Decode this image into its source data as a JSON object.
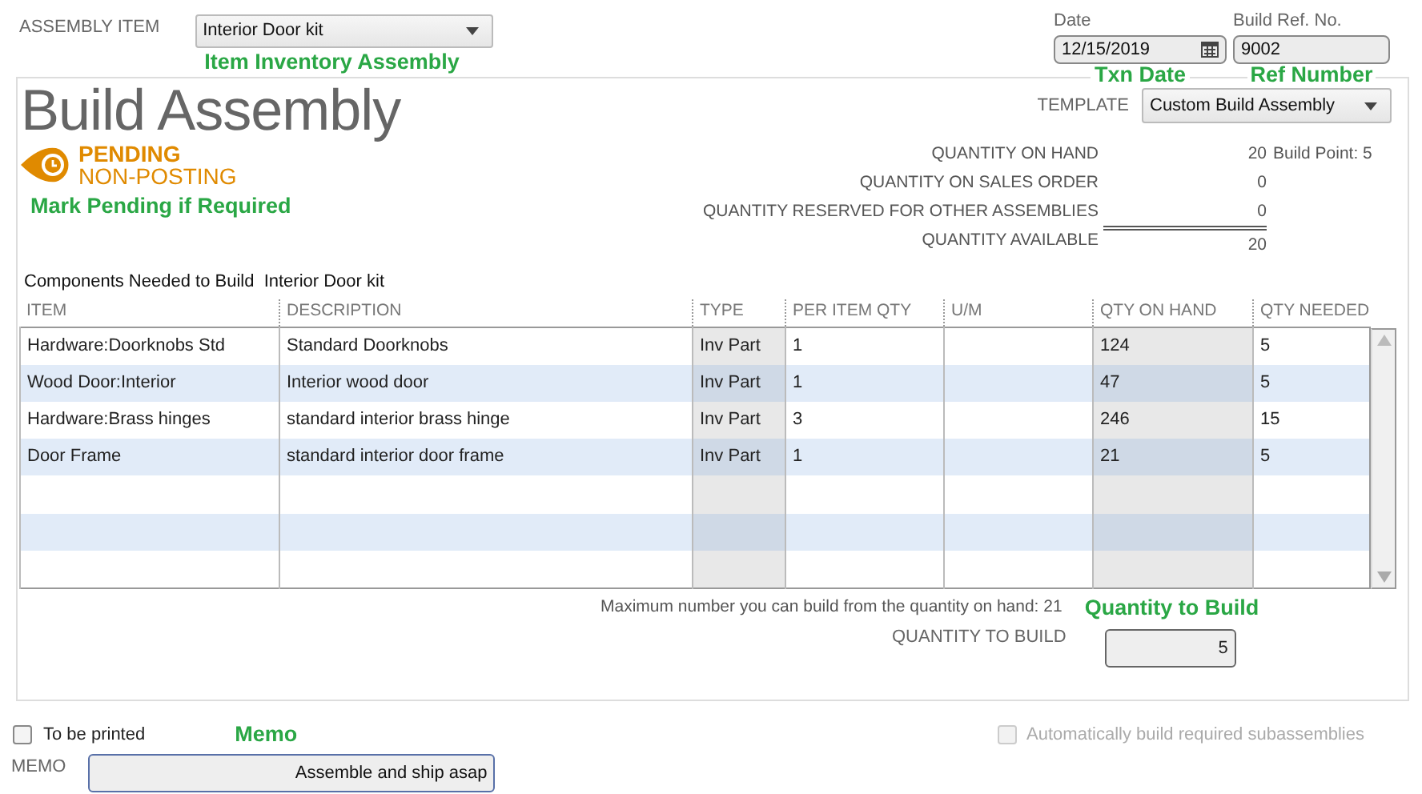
{
  "assembly_item": {
    "label": "ASSEMBLY ITEM",
    "value": "Interior Door kit",
    "annotation": "Item Inventory Assembly"
  },
  "date": {
    "label": "Date",
    "value": "12/15/2019",
    "annotation": "Txn Date"
  },
  "ref_no": {
    "label": "Build Ref. No.",
    "value": "9002",
    "annotation": "Ref Number"
  },
  "title": "Build Assembly",
  "template": {
    "label": "TEMPLATE",
    "value": "Custom Build Assembly"
  },
  "status": {
    "kind": "pending",
    "line1": "PENDING",
    "line2": "NON-POSTING",
    "annotation": "Mark Pending if Required"
  },
  "quantities": [
    {
      "label": "QUANTITY ON HAND",
      "value": "20",
      "note": "Build Point: 5"
    },
    {
      "label": "QUANTITY ON SALES ORDER",
      "value": "0"
    },
    {
      "label": "QUANTITY RESERVED FOR OTHER ASSEMBLIES",
      "value": "0"
    },
    {
      "label": "QUANTITY AVAILABLE",
      "value": "20",
      "total": true
    }
  ],
  "components_heading": "Components Needed to Build  Interior Door kit",
  "table": {
    "columns": [
      "ITEM",
      "DESCRIPTION",
      "TYPE",
      "PER ITEM QTY",
      "U/M",
      "QTY ON HAND",
      "QTY NEEDED"
    ],
    "rows": [
      [
        "Hardware:Doorknobs Std",
        "Standard Doorknobs",
        "Inv Part",
        "1",
        "",
        "124",
        "5"
      ],
      [
        "Wood Door:Interior",
        "Interior wood door",
        "Inv Part",
        "1",
        "",
        "47",
        "5"
      ],
      [
        "Hardware:Brass hinges",
        "standard interior brass hinge",
        "Inv Part",
        "3",
        "",
        "246",
        "15"
      ],
      [
        "Door Frame",
        "standard interior door frame",
        "Inv Part",
        "1",
        "",
        "21",
        "5"
      ]
    ]
  },
  "max_build_note": "Maximum number you can build from the quantity on hand: 21",
  "quantity_to_build": {
    "label": "QUANTITY TO BUILD",
    "value": "5",
    "annotation": "Quantity to Build"
  },
  "to_be_printed": {
    "label": "To be printed",
    "checked": false
  },
  "memo_annotation": "Memo",
  "auto_build": {
    "label": "Automatically build required subassemblies",
    "checked": false,
    "disabled": true
  },
  "memo": {
    "label": "MEMO",
    "value": "Assemble and ship asap"
  }
}
